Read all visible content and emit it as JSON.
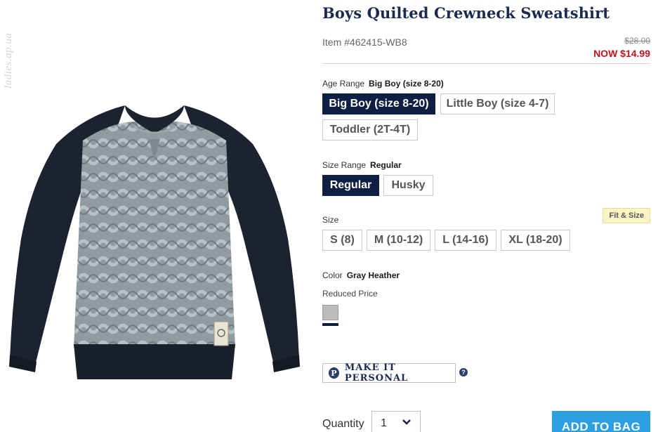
{
  "product": {
    "watermark": "ladies.ap.ua",
    "title": "Boys Quilted Crewneck Sweatshirt",
    "item_number": "Item #462415-WB8",
    "price_was": "$28.00",
    "price_now": "NOW $14.99"
  },
  "age_range": {
    "label": "Age Range",
    "selected": "Big Boy (size 8-20)",
    "options": [
      "Big Boy (size 8-20)",
      "Little Boy (size 4-7)",
      "Toddler (2T-4T)"
    ]
  },
  "size_range": {
    "label": "Size Range",
    "selected": "Regular",
    "options": [
      "Regular",
      "Husky"
    ]
  },
  "size": {
    "label": "Size",
    "fit_link": "Fit & Size",
    "options": [
      "S (8)",
      "M (10-12)",
      "L (14-16)",
      "XL (18-20)"
    ]
  },
  "color": {
    "label": "Color",
    "selected": "Gray Heather",
    "group_label": "Reduced Price",
    "swatch_color": "#bcbcbc"
  },
  "personal": {
    "icon_letter": "P",
    "label": "MAKE IT PERSONAL",
    "help": "?"
  },
  "quantity": {
    "label": "Quantity",
    "value": "1"
  },
  "cart": {
    "add_label": "ADD TO BAG"
  },
  "colors": {
    "navy": "#0f1f44",
    "sale_red": "#c0141c",
    "add_blue": "#2b9fe0"
  }
}
